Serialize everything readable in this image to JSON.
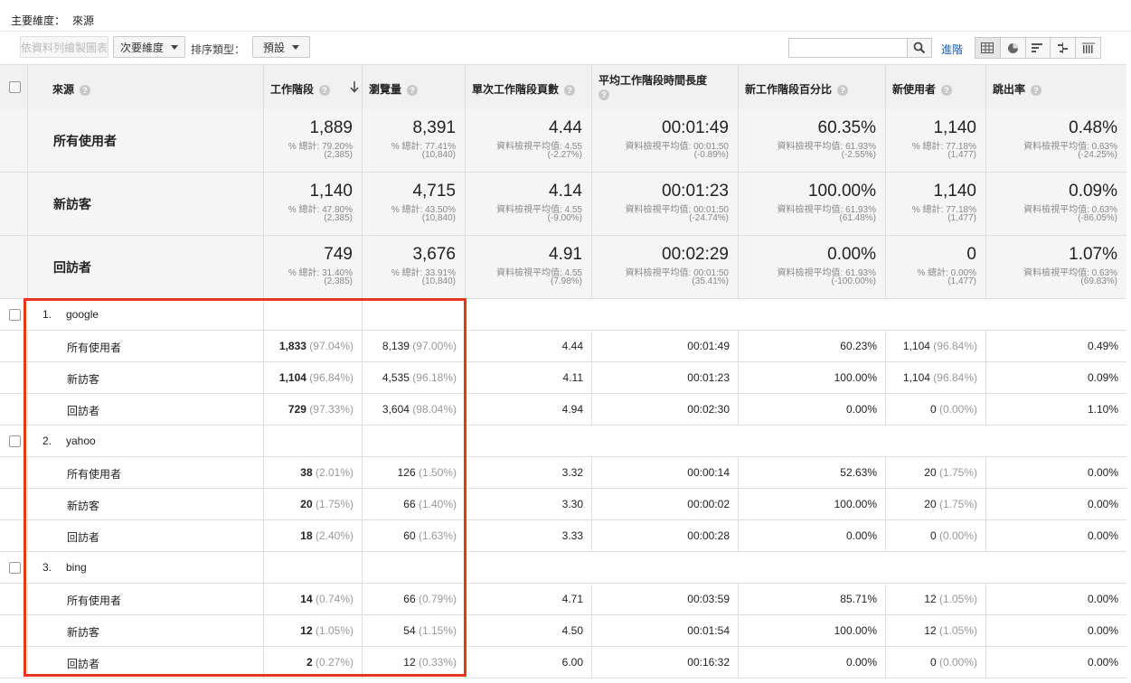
{
  "primary_dimension": {
    "label": "主要維度：",
    "value": "來源"
  },
  "toolbar": {
    "plot_rows_label": "依資料列繪製圖表",
    "secondary_dimension_label": "次要維度",
    "sort_type_label": "排序類型：",
    "sort_default_label": "預設",
    "advanced_label": "進階"
  },
  "columns": [
    {
      "label": "來源"
    },
    {
      "label": "工作階段"
    },
    {
      "label": "瀏覽量"
    },
    {
      "label": "單次工作階段頁數"
    },
    {
      "label": "平均工作階段時間長度"
    },
    {
      "label": "新工作階段百分比"
    },
    {
      "label": "新使用者"
    },
    {
      "label": "跳出率"
    }
  ],
  "summary": [
    {
      "segment": "所有使用者",
      "cells": [
        {
          "v": "1,889",
          "s1": "% 總計: 79.20%",
          "s2": "(2,385)"
        },
        {
          "v": "8,391",
          "s1": "% 總計: 77.41%",
          "s2": "(10,840)"
        },
        {
          "v": "4.44",
          "s1": "資料檢視平均值: 4.55",
          "s2": "(-2.27%)"
        },
        {
          "v": "00:01:49",
          "s1": "資料檢視平均值: 00:01:50",
          "s2": "(-0.89%)"
        },
        {
          "v": "60.35%",
          "s1": "資料檢視平均值: 61.93%",
          "s2": "(-2.55%)"
        },
        {
          "v": "1,140",
          "s1": "% 總計: 77.18%",
          "s2": "(1,477)"
        },
        {
          "v": "0.48%",
          "s1": "資料檢視平均值: 0.63%",
          "s2": "(-24.25%)"
        }
      ]
    },
    {
      "segment": "新訪客",
      "cells": [
        {
          "v": "1,140",
          "s1": "% 總計: 47.80%",
          "s2": "(2,385)"
        },
        {
          "v": "4,715",
          "s1": "% 總計: 43.50%",
          "s2": "(10,840)"
        },
        {
          "v": "4.14",
          "s1": "資料檢視平均值: 4.55",
          "s2": "(-9.00%)"
        },
        {
          "v": "00:01:23",
          "s1": "資料檢視平均值: 00:01:50",
          "s2": "(-24.74%)"
        },
        {
          "v": "100.00%",
          "s1": "資料檢視平均值: 61.93%",
          "s2": "(61.48%)"
        },
        {
          "v": "1,140",
          "s1": "% 總計: 77.18%",
          "s2": "(1,477)"
        },
        {
          "v": "0.09%",
          "s1": "資料檢視平均值: 0.63%",
          "s2": "(-86.05%)"
        }
      ]
    },
    {
      "segment": "回訪者",
      "cells": [
        {
          "v": "749",
          "s1": "% 總計: 31.40%",
          "s2": "(2,385)"
        },
        {
          "v": "3,676",
          "s1": "% 總計: 33.91%",
          "s2": "(10,840)"
        },
        {
          "v": "4.91",
          "s1": "資料檢視平均值: 4.55",
          "s2": "(7.98%)"
        },
        {
          "v": "00:02:29",
          "s1": "資料檢視平均值: 00:01:50",
          "s2": "(35.41%)"
        },
        {
          "v": "0.00%",
          "s1": "資料檢視平均值: 61.93%",
          "s2": "(-100.00%)"
        },
        {
          "v": "0",
          "s1": "% 總計: 0.00%",
          "s2": "(1,477)"
        },
        {
          "v": "1.07%",
          "s1": "資料檢視平均值: 0.63%",
          "s2": "(69.83%)"
        }
      ]
    }
  ],
  "sources": [
    {
      "index": "1.",
      "name": "google",
      "rows": [
        {
          "segment": "所有使用者",
          "sessions": "1,833",
          "sessions_pct": "(97.04%)",
          "pageviews": "8,139",
          "pageviews_pct": "(97.00%)",
          "pages": "4.44",
          "duration": "00:01:49",
          "new_pct": "60.23%",
          "new_users": "1,104",
          "new_users_pct": "(96.84%)",
          "bounce": "0.49%"
        },
        {
          "segment": "新訪客",
          "sessions": "1,104",
          "sessions_pct": "(96.84%)",
          "pageviews": "4,535",
          "pageviews_pct": "(96.18%)",
          "pages": "4.11",
          "duration": "00:01:23",
          "new_pct": "100.00%",
          "new_users": "1,104",
          "new_users_pct": "(96.84%)",
          "bounce": "0.09%"
        },
        {
          "segment": "回訪者",
          "sessions": "729",
          "sessions_pct": "(97.33%)",
          "pageviews": "3,604",
          "pageviews_pct": "(98.04%)",
          "pages": "4.94",
          "duration": "00:02:30",
          "new_pct": "0.00%",
          "new_users": "0",
          "new_users_pct": "(0.00%)",
          "bounce": "1.10%"
        }
      ]
    },
    {
      "index": "2.",
      "name": "yahoo",
      "rows": [
        {
          "segment": "所有使用者",
          "sessions": "38",
          "sessions_pct": "(2.01%)",
          "pageviews": "126",
          "pageviews_pct": "(1.50%)",
          "pages": "3.32",
          "duration": "00:00:14",
          "new_pct": "52.63%",
          "new_users": "20",
          "new_users_pct": "(1.75%)",
          "bounce": "0.00%"
        },
        {
          "segment": "新訪客",
          "sessions": "20",
          "sessions_pct": "(1.75%)",
          "pageviews": "66",
          "pageviews_pct": "(1.40%)",
          "pages": "3.30",
          "duration": "00:00:02",
          "new_pct": "100.00%",
          "new_users": "20",
          "new_users_pct": "(1.75%)",
          "bounce": "0.00%"
        },
        {
          "segment": "回訪者",
          "sessions": "18",
          "sessions_pct": "(2.40%)",
          "pageviews": "60",
          "pageviews_pct": "(1.63%)",
          "pages": "3.33",
          "duration": "00:00:28",
          "new_pct": "0.00%",
          "new_users": "0",
          "new_users_pct": "(0.00%)",
          "bounce": "0.00%"
        }
      ]
    },
    {
      "index": "3.",
      "name": "bing",
      "rows": [
        {
          "segment": "所有使用者",
          "sessions": "14",
          "sessions_pct": "(0.74%)",
          "pageviews": "66",
          "pageviews_pct": "(0.79%)",
          "pages": "4.71",
          "duration": "00:03:59",
          "new_pct": "85.71%",
          "new_users": "12",
          "new_users_pct": "(1.05%)",
          "bounce": "0.00%"
        },
        {
          "segment": "新訪客",
          "sessions": "12",
          "sessions_pct": "(1.05%)",
          "pageviews": "54",
          "pageviews_pct": "(1.15%)",
          "pages": "4.50",
          "duration": "00:01:54",
          "new_pct": "100.00%",
          "new_users": "12",
          "new_users_pct": "(1.05%)",
          "bounce": "0.00%"
        },
        {
          "segment": "回訪者",
          "sessions": "2",
          "sessions_pct": "(0.27%)",
          "pageviews": "12",
          "pageviews_pct": "(0.33%)",
          "pages": "6.00",
          "duration": "00:16:32",
          "new_pct": "0.00%",
          "new_users": "0",
          "new_users_pct": "(0.00%)",
          "bounce": "0.00%"
        }
      ]
    }
  ],
  "colors": {
    "highlight": "#e8351f",
    "link": "#1a5fb4"
  }
}
